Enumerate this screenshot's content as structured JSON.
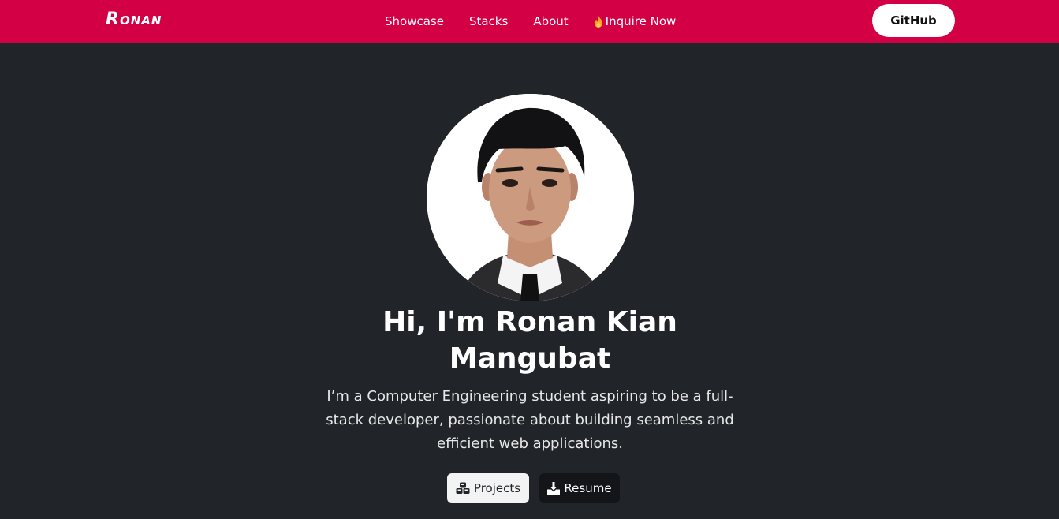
{
  "brand": {
    "logo_text": "Ronan"
  },
  "nav": {
    "links": [
      {
        "label": "Showcase"
      },
      {
        "label": "Stacks"
      },
      {
        "label": "About"
      },
      {
        "label": "Inquire Now",
        "icon": "flame-icon"
      }
    ],
    "github_label": "GitHub"
  },
  "colors": {
    "navbar": "#d30045",
    "background": "#212429",
    "projects_button": "#f3f3f4",
    "resume_button": "#141518"
  },
  "hero": {
    "avatar": "profile-photo",
    "title": "Hi, I'm Ronan Kian Mangubat",
    "description": "I’m a Computer Engineering student aspiring to be a full-stack developer, passionate about building seamless and efficient web applications.",
    "buttons": {
      "projects_label": "Projects",
      "projects_icon": "cubes-icon",
      "resume_label": "Resume",
      "resume_icon": "download-icon"
    }
  }
}
